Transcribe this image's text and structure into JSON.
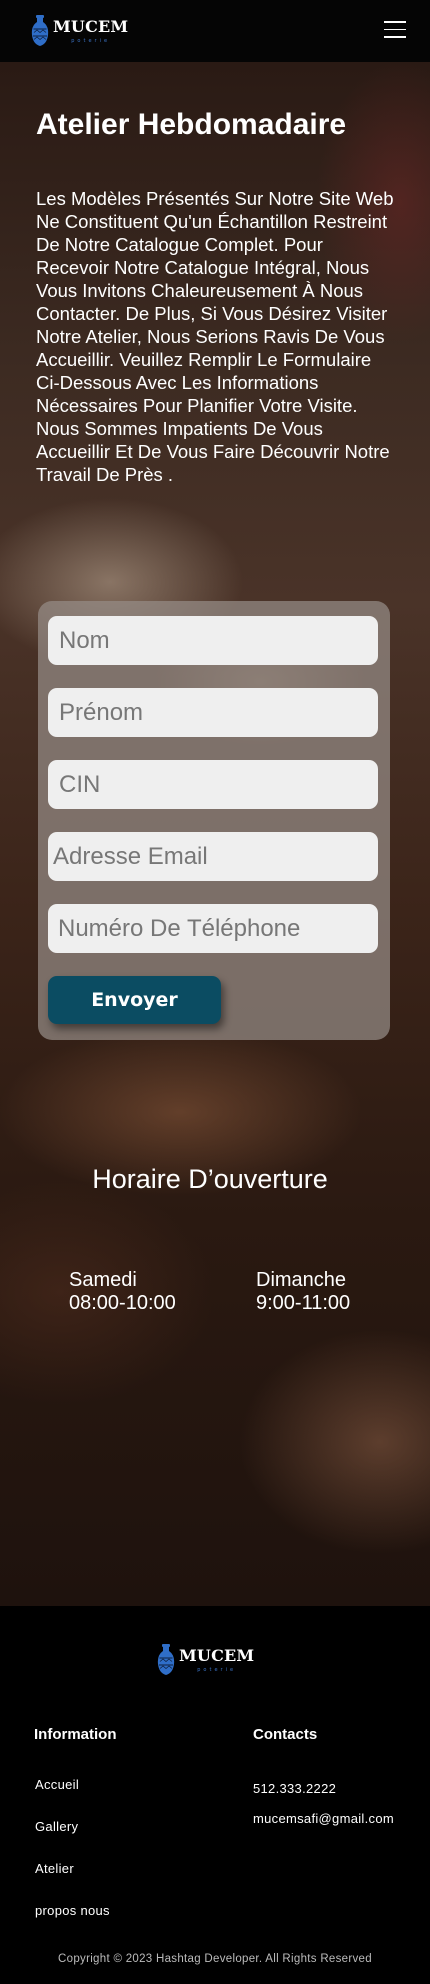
{
  "brand": {
    "name": "MUCEM",
    "tagline": "poterie"
  },
  "header": {
    "menu_icon": "hamburger-menu-icon"
  },
  "main": {
    "title": "Atelier Hebdomadaire",
    "intro": " Les Modèles Présentés Sur Notre Site Web Ne Constituent Qu'un Échantillon Restreint De Notre Catalogue Complet. Pour Recevoir Notre Catalogue Intégral, Nous Vous Invitons Chaleureusement À Nous Contacter. De Plus, Si Vous Désirez Visiter Notre Atelier, Nous Serions Ravis De Vous Accueillir. Veuillez Remplir Le Formulaire Ci-Dessous Avec Les Informations Nécessaires Pour Planifier Votre Visite. Nous Sommes Impatients De Vous Accueillir Et De Vous Faire Découvrir Notre Travail De Près ."
  },
  "form": {
    "nom_placeholder": "Nom",
    "prenom_placeholder": "Prénom",
    "cin_placeholder": "CIN",
    "email_placeholder": "Adresse Email",
    "phone_placeholder": "Numéro De Téléphone",
    "submit_label": "Envoyer"
  },
  "hours": {
    "title": "Horaire D’ouverture",
    "days": [
      {
        "day": "Samedi",
        "time": "08:00-10:00"
      },
      {
        "day": "Dimanche",
        "time": "9:00-11:00"
      }
    ]
  },
  "footer": {
    "information_heading": "Information",
    "links": [
      "Accueil",
      "Gallery",
      "Atelier",
      "propos nous"
    ],
    "contacts_heading": "Contacts",
    "phone": "512.333.2222",
    "email": "mucemsafi@gmail.com",
    "copyright": "Copyright © 2023 Hashtag Developer. All Rights Reserved"
  },
  "colors": {
    "button": "#0b4c62",
    "logo_blue": "#3c74c7"
  }
}
